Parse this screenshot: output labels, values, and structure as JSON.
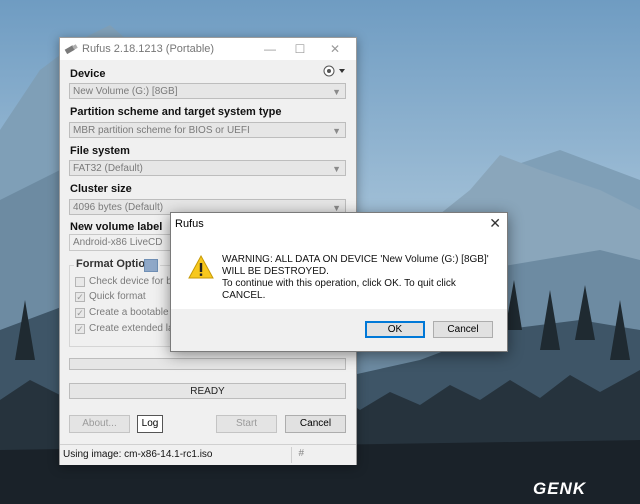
{
  "window": {
    "title": "Rufus 2.18.1213 (Portable)",
    "device_label": "Device",
    "device_value": "New Volume (G:) [8GB]",
    "partition_label": "Partition scheme and target system type",
    "partition_value": "MBR partition scheme for BIOS or UEFI",
    "fs_label": "File system",
    "fs_value": "FAT32 (Default)",
    "cluster_label": "Cluster size",
    "cluster_value": "4096 bytes (Default)",
    "volume_label_label": "New volume label",
    "volume_label_value": "Android-x86 LiveCD",
    "format_options": "Format Options",
    "options": [
      {
        "label": "Check device for ba",
        "checked": false
      },
      {
        "label": "Quick format",
        "checked": true
      },
      {
        "label": "Create a bootable c",
        "checked": true
      },
      {
        "label": "Create extended lab",
        "checked": true
      }
    ],
    "status_text": "READY",
    "buttons": {
      "about": "About...",
      "log": "Log",
      "start": "Start",
      "cancel": "Cancel"
    },
    "statusbar": "Using image: cm-x86-14.1-rc1.iso",
    "hash_symbol": "#"
  },
  "dialog": {
    "title": "Rufus",
    "line1": "WARNING: ALL DATA ON DEVICE 'New Volume (G:) [8GB]' WILL BE DESTROYED.",
    "line2": "To continue with this operation, click OK. To quit click CANCEL.",
    "ok": "OK",
    "cancel": "Cancel"
  },
  "watermark": "GENK"
}
